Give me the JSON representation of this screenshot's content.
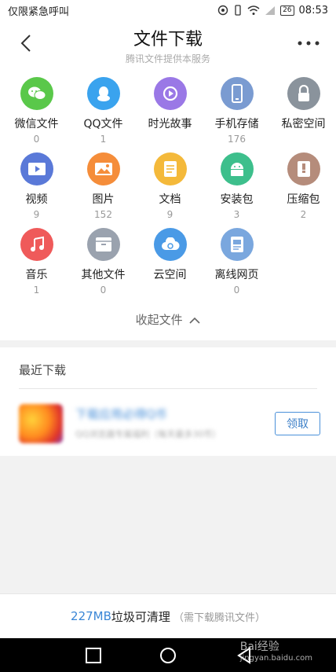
{
  "status_bar": {
    "left_text": "仅限紧急呼叫",
    "battery": "26",
    "time": "08:53"
  },
  "header": {
    "title": "文件下载",
    "subtitle": "腾讯文件提供本服务"
  },
  "categories": [
    {
      "label": "微信文件",
      "count": "0",
      "icon": "wechat-icon",
      "color": "#5ac84a"
    },
    {
      "label": "QQ文件",
      "count": "1",
      "icon": "qq-penguin-icon",
      "color": "#3aa3ee"
    },
    {
      "label": "时光故事",
      "count": "",
      "icon": "play-circle-icon",
      "color": "#9a78e6"
    },
    {
      "label": "手机存储",
      "count": "176",
      "icon": "phone-icon",
      "color": "#7a9bd1"
    },
    {
      "label": "私密空间",
      "count": "",
      "icon": "lock-icon",
      "color": "#8a939c"
    },
    {
      "label": "视频",
      "count": "9",
      "icon": "video-icon",
      "color": "#5a79d8"
    },
    {
      "label": "图片",
      "count": "152",
      "icon": "image-icon",
      "color": "#f58d3a"
    },
    {
      "label": "文档",
      "count": "9",
      "icon": "document-icon",
      "color": "#f4b93a"
    },
    {
      "label": "安装包",
      "count": "3",
      "icon": "android-icon",
      "color": "#3dbf8c"
    },
    {
      "label": "压缩包",
      "count": "2",
      "icon": "archive-icon",
      "color": "#b58c7b"
    },
    {
      "label": "音乐",
      "count": "1",
      "icon": "music-icon",
      "color": "#ef5a5a"
    },
    {
      "label": "其他文件",
      "count": "0",
      "icon": "other-file-icon",
      "color": "#9aa2ae"
    },
    {
      "label": "云空间",
      "count": "",
      "icon": "cloud-icon",
      "color": "#4a9ae6"
    },
    {
      "label": "离线网页",
      "count": "0",
      "icon": "offline-page-icon",
      "color": "#7aa7de"
    }
  ],
  "collapse_label": "收起文件",
  "recent": {
    "title": "最近下载",
    "promo_title": "下载应用必得Q币",
    "promo_desc": "QQ浏览器专属福利（每天最多30币）",
    "claim_label": "领取"
  },
  "cleanup": {
    "size": "227MB",
    "text": "垃圾可清理",
    "hint": "（需下载腾讯文件）"
  },
  "watermark": {
    "brand": "Bai经验",
    "url": "jingyan.baidu.com"
  },
  "colors": {
    "accent": "#3a86d6",
    "background": "#f2f2f2"
  }
}
